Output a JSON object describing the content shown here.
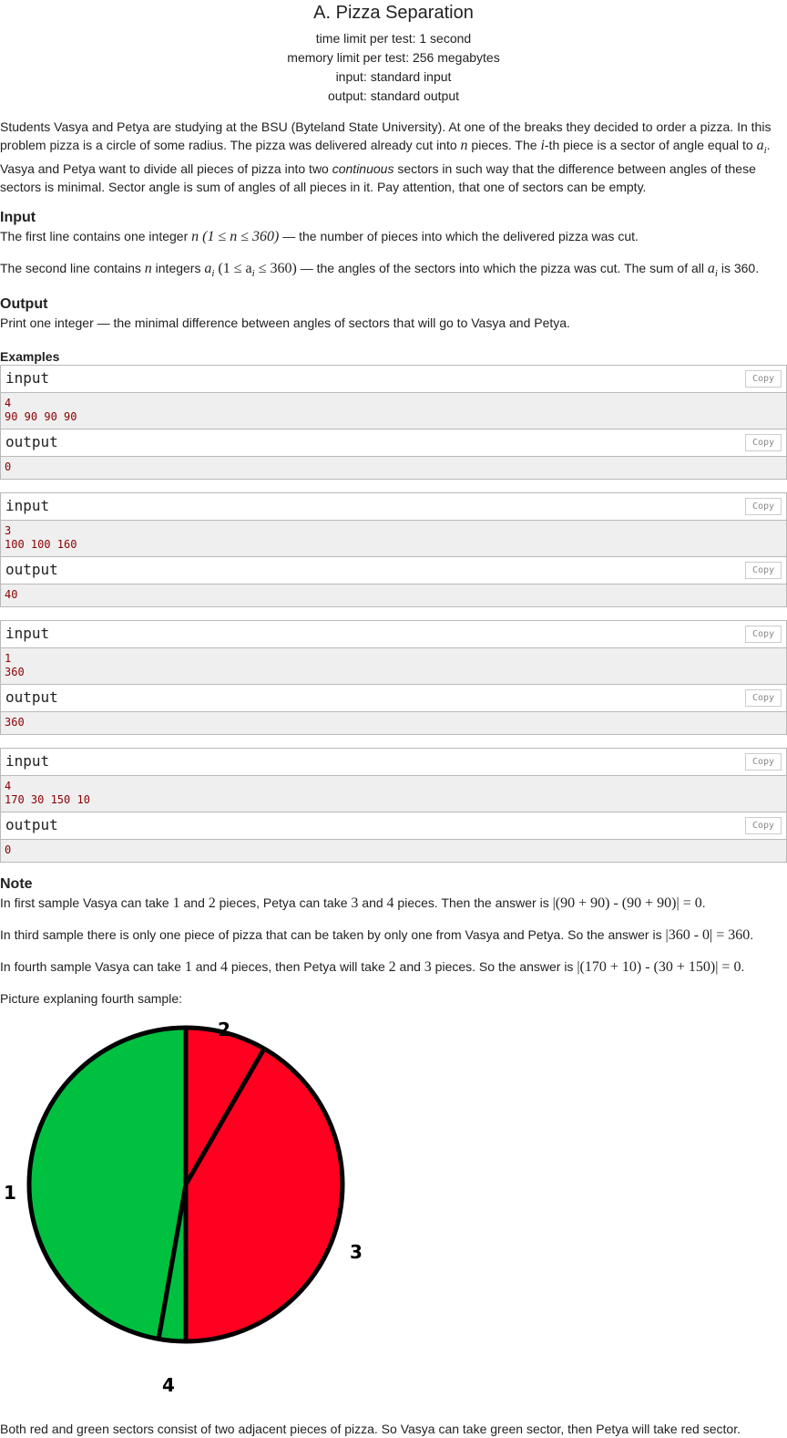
{
  "problem": {
    "title": "A. Pizza Separation",
    "time_limit": "time limit per test: 1 second",
    "memory_limit": "memory limit per test: 256 megabytes",
    "input": "input: standard input",
    "output": "output: standard output"
  },
  "statement": {
    "p1_a": "Students Vasya and Petya are studying at the BSU (Byteland State University). At one of the breaks they decided to order a pizza. In this problem pizza is a circle of some radius. The pizza was delivered already cut into ",
    "p1_n": "n",
    "p1_b": " pieces. The ",
    "p1_i": "i",
    "p1_c": "-th piece is a sector of angle equal to ",
    "p1_ai": "a",
    "p1_ai_sub": "i",
    "p1_d": ". Vasya and Petya want to divide all pieces of pizza into two ",
    "p1_em": "continuous",
    "p1_e": " sectors in such way that the difference between angles of these sectors is minimal. Sector angle is sum of angles of all pieces in it. Pay attention, that one of sectors can be empty."
  },
  "input_section": {
    "title": "Input",
    "l1_a": "The first line contains one integer ",
    "l1_math": "n (1 ≤ n ≤ 360)",
    "l1_b": " — the number of pieces into which the delivered pizza was cut.",
    "l2_a": "The second line contains ",
    "l2_n": "n",
    "l2_b": " integers ",
    "l2_math": "a",
    "l2_sub": "i",
    "l2_math2": " (1 ≤ a",
    "l2_sub2": "i",
    "l2_math3": " ≤ 360)",
    "l2_c": " — the angles of the sectors into which the pizza was cut. The sum of all ",
    "l2_d": " is 360."
  },
  "output_section": {
    "title": "Output",
    "text": "Print one integer  — the minimal difference between angles of sectors that will go to Vasya and Petya."
  },
  "examples": {
    "title": "Examples",
    "input_label": "input",
    "output_label": "output",
    "copy_label": "Copy",
    "items": [
      {
        "input": "4\n90 90 90 90",
        "output": "0"
      },
      {
        "input": "3\n100 100 160",
        "output": "40"
      },
      {
        "input": "1\n360",
        "output": "360"
      },
      {
        "input": "4\n170 30 150 10",
        "output": "0"
      }
    ]
  },
  "note": {
    "title": "Note",
    "n1_a": "In first sample Vasya can take ",
    "n1_1": "1",
    "n1_b": " and ",
    "n1_2": "2",
    "n1_c": " pieces, Petya can take ",
    "n1_3": "3",
    "n1_d": " and ",
    "n1_4": "4",
    "n1_e": " pieces. Then the answer is ",
    "n1_math": "|(90 + 90) - (90 + 90)| = 0",
    "n1_f": ".",
    "n2_a": "In third sample there is only one piece of pizza that can be taken by only one from Vasya and Petya. So the answer is ",
    "n2_math": "|360 - 0| = 360",
    "n2_b": ".",
    "n3_a": "In fourth sample Vasya can take ",
    "n3_1": "1",
    "n3_b": " and ",
    "n3_4": "4",
    "n3_c": " pieces, then Petya will take ",
    "n3_2": "2",
    "n3_d": " and ",
    "n3_3": "3",
    "n3_e": " pieces. So the answer is ",
    "n3_math": "|(170 + 10) - (30 + 150)| = 0",
    "n3_f": ".",
    "picture_caption": "Picture explaning fourth sample:",
    "final": "Both red and green sectors consist of two adjacent pieces of pizza. So Vasya can take green sector, then Petya will take red sector."
  },
  "picture": {
    "labels": {
      "p1": "1",
      "p2": "2",
      "p3": "3",
      "p4": "4"
    },
    "colors": {
      "green": "#00c040",
      "red": "#ff0020",
      "outline": "#000000"
    },
    "angles_deg": {
      "p2": 30,
      "p3": 150,
      "p4": 10,
      "p1": 170
    }
  }
}
